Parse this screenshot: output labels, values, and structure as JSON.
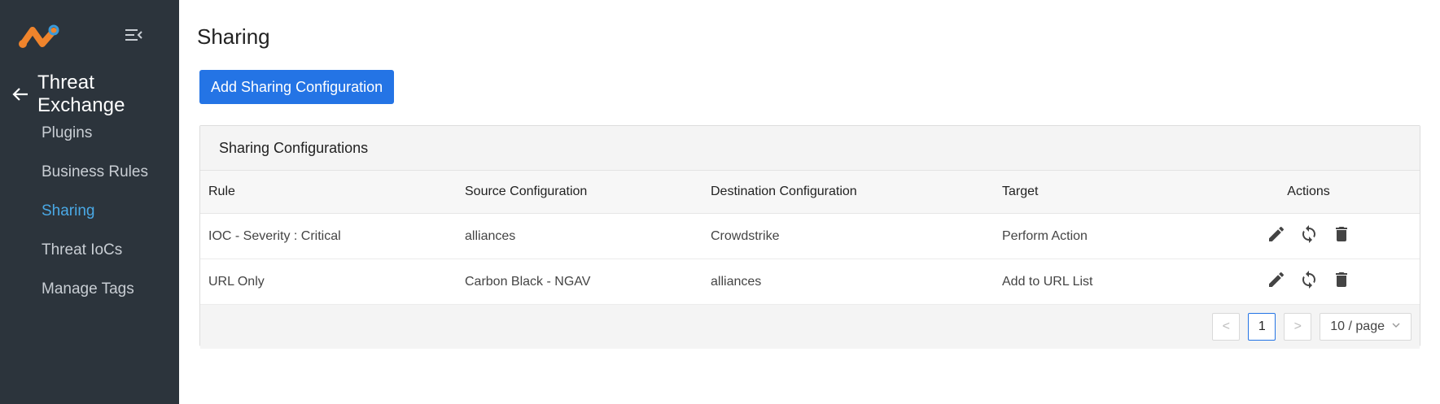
{
  "sidebar": {
    "back_title": "Threat Exchange",
    "items": [
      {
        "label": "Plugins",
        "active": false
      },
      {
        "label": "Business Rules",
        "active": false
      },
      {
        "label": "Sharing",
        "active": true
      },
      {
        "label": "Threat IoCs",
        "active": false
      },
      {
        "label": "Manage Tags",
        "active": false
      }
    ]
  },
  "main": {
    "title": "Sharing",
    "add_button": "Add Sharing Configuration",
    "card_title": "Sharing Configurations",
    "table": {
      "columns": [
        "Rule",
        "Source Configuration",
        "Destination Configuration",
        "Target",
        "Actions"
      ],
      "rows": [
        {
          "rule": "IOC - Severity : Critical",
          "source": "alliances",
          "destination": "Crowdstrike",
          "target": "Perform Action"
        },
        {
          "rule": "URL Only",
          "source": "Carbon Black - NGAV",
          "destination": "alliances",
          "target": "Add to URL List"
        }
      ]
    },
    "pagination": {
      "prev": "<",
      "current_page": "1",
      "next": ">",
      "page_size": "10 / page"
    }
  },
  "colors": {
    "sidebar_bg": "#2c343c",
    "accent": "#2474e5",
    "active_nav": "#4aa9e6",
    "logo_orange": "#f0842c",
    "logo_blue": "#3b9ad9"
  },
  "icons": [
    "logo",
    "menu-collapse-icon",
    "arrow-left-icon",
    "edit-icon",
    "sync-icon",
    "trash-icon",
    "chevron-down-icon"
  ]
}
